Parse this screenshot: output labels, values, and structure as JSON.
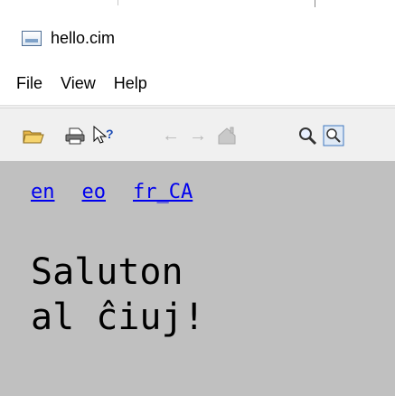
{
  "window": {
    "title": "hello.cim",
    "icon": "app-window-icon"
  },
  "menu": [
    "File",
    "View",
    "Help"
  ],
  "toolbar": [
    {
      "name": "open-folder-icon",
      "glyph": "📂",
      "enabled": true
    },
    {
      "name": "print-icon",
      "glyph": "🖨",
      "enabled": true
    },
    {
      "name": "help-cursor-icon",
      "glyph": "⁇",
      "enabled": true
    },
    {
      "name": "back-arrow-icon",
      "glyph": "←",
      "enabled": false
    },
    {
      "name": "forward-arrow-icon",
      "glyph": "→",
      "enabled": false
    },
    {
      "name": "home-icon",
      "glyph": "⌂",
      "enabled": false
    },
    {
      "name": "magnify-icon",
      "glyph": "🔍",
      "enabled": true
    },
    {
      "name": "zoom-box-icon",
      "glyph": "🔎",
      "enabled": true
    }
  ],
  "content": {
    "languages": [
      "en",
      "eo",
      "fr_CA"
    ],
    "greeting_line1": "Saluton",
    "greeting_line2": "al ĉiuj!"
  }
}
